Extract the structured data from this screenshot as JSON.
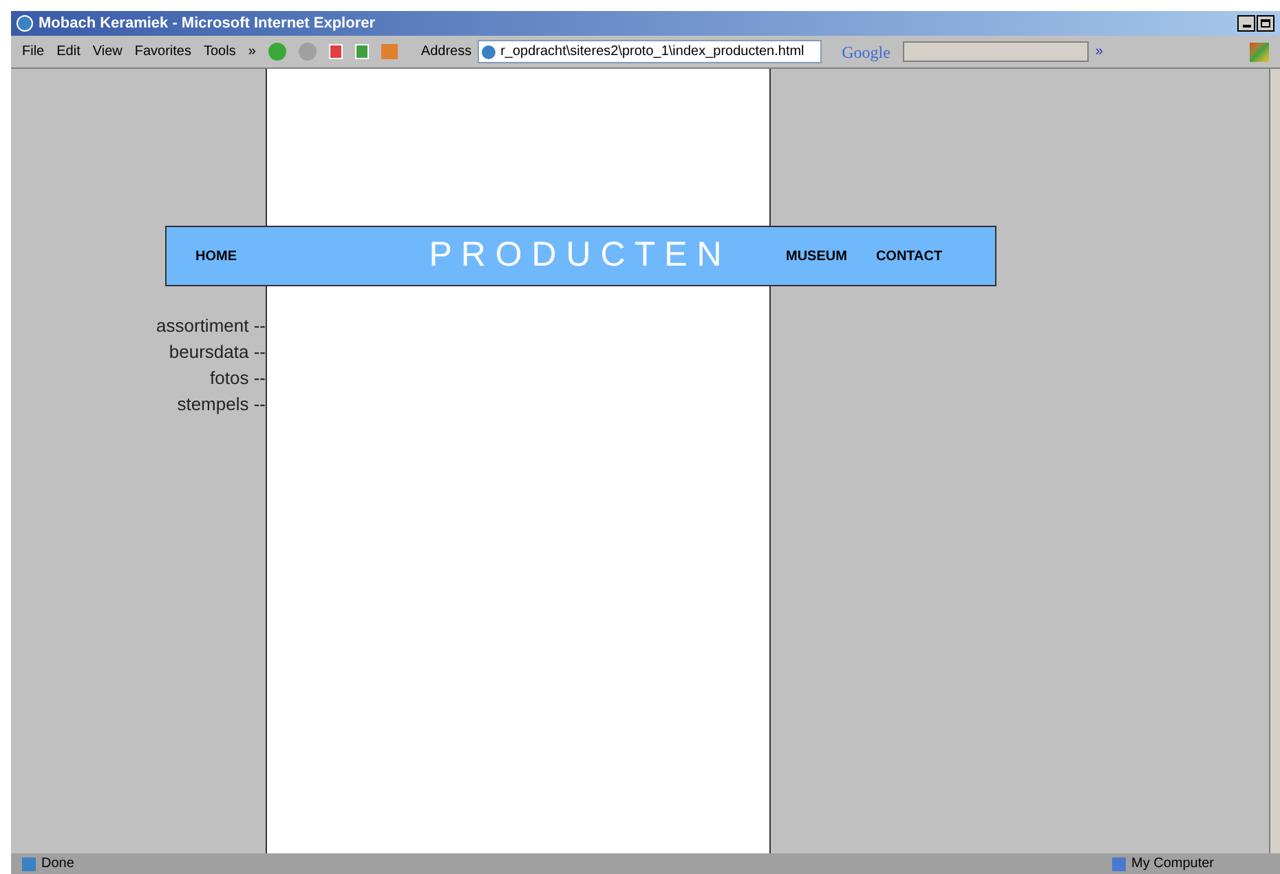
{
  "window": {
    "title": "Mobach Keramiek - Microsoft Internet Explorer"
  },
  "menu": [
    "File",
    "Edit",
    "View",
    "Favorites",
    "Tools",
    "»"
  ],
  "address": {
    "label": "Address",
    "value": "r_opdracht\\siteres2\\proto_1\\index_producten.html"
  },
  "search": {
    "label": "Google",
    "more": "»"
  },
  "page": {
    "nav_left": "HOME",
    "title": "P R O D U C T E N",
    "nav_right": [
      "MUSEUM",
      "CONTACT"
    ],
    "side_links": [
      "assortiment --",
      "beursdata --",
      "fotos --",
      "stempels --"
    ]
  },
  "status_bar": {
    "text": "Done",
    "zone": "My Computer"
  }
}
